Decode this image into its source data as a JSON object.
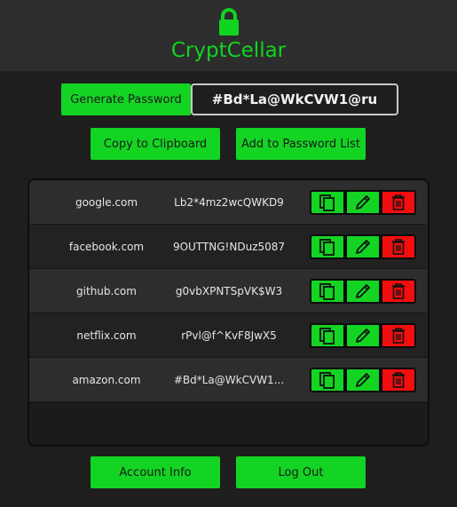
{
  "app": {
    "title": "CryptCellar"
  },
  "generator": {
    "generate_label": "Generate Password",
    "generated_password": "#Bd*La@WkCVW1@ru",
    "copy_label": "Copy to Clipboard",
    "add_label": "Add to Password List"
  },
  "passwords": [
    {
      "site": "google.com",
      "password": "Lb2*4mz2wcQWKD9"
    },
    {
      "site": "facebook.com",
      "password": "9OUTTNG!NDuz5087"
    },
    {
      "site": "github.com",
      "password": "g0vbXPNTSpVK$W3"
    },
    {
      "site": "netflix.com",
      "password": "rPvl@f^KvF8JwX5"
    },
    {
      "site": "amazon.com",
      "password": "#Bd*La@WkCVW1..."
    }
  ],
  "footer": {
    "account_label": "Account Info",
    "logout_label": "Log Out"
  },
  "icons": {
    "lock": "lock-icon",
    "copy": "copy-icon",
    "edit": "pencil-icon",
    "delete": "trash-icon"
  },
  "colors": {
    "accent": "#14d423",
    "danger": "#f20e0e",
    "background": "#1e1e1e",
    "header": "#2d2d2d"
  }
}
